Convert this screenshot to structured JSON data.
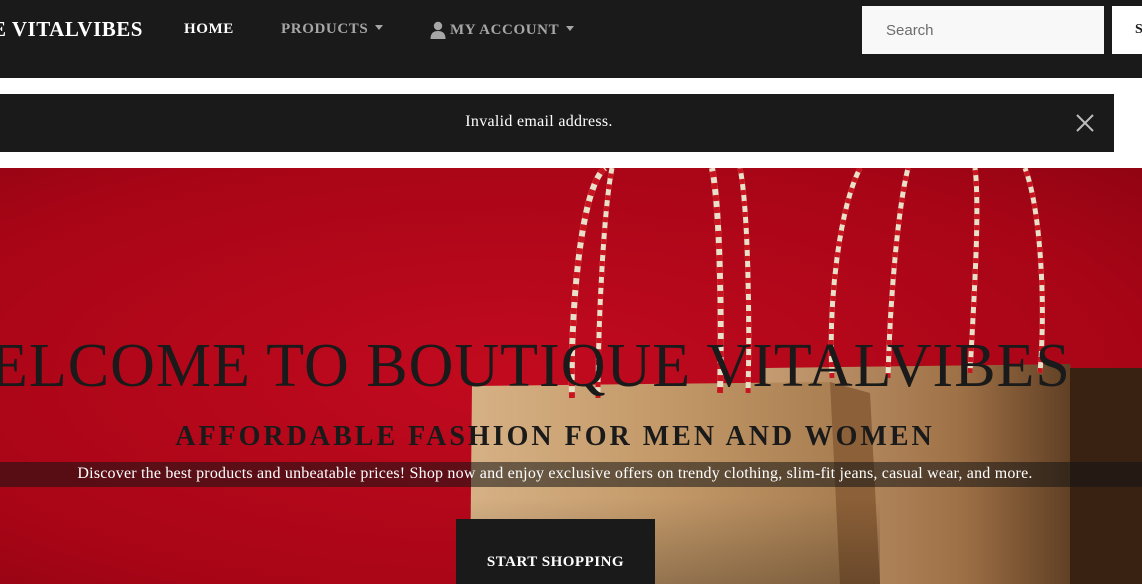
{
  "navbar": {
    "brand": "E VITALVIBES",
    "links": {
      "home": "HOME",
      "products": "PRODUCTS",
      "account": "MY ACCOUNT"
    },
    "search": {
      "placeholder": "Search",
      "button_label": "S"
    },
    "icons": {
      "account": "user-icon",
      "dropdown": "caret-down-icon"
    }
  },
  "alert": {
    "message": "Invalid email address.",
    "close_icon": "close-icon"
  },
  "hero": {
    "title": "ELCOME TO BOUTIQUE VITALVIBES",
    "subtitle": "AFFORDABLE FASHION FOR MEN AND WOMEN",
    "description": "Discover the best products and unbeatable prices! Shop now and enjoy exclusive offers on trendy clothing, slim-fit jeans, casual wear, and more.",
    "cta_label": "START SHOPPING"
  },
  "colors": {
    "navbar_bg": "#1a1a1a",
    "hero_red": "#b3061a",
    "bag_kraft": "#c9a173",
    "text_dark": "#1a1a1a"
  }
}
